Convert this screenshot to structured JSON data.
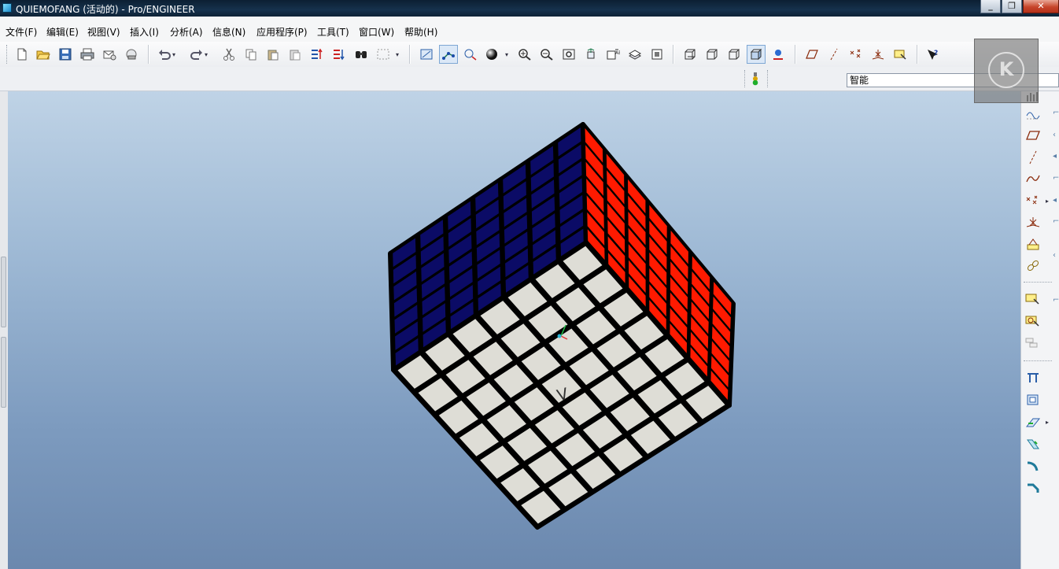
{
  "window": {
    "title": "QUIEMOFANG (活动的) - Pro/ENGINEER",
    "minimize": "_",
    "restore": "❐",
    "close": "✕"
  },
  "menu": [
    "文件(F)",
    "编辑(E)",
    "视图(V)",
    "插入(I)",
    "分析(A)",
    "信息(N)",
    "应用程序(P)",
    "工具(T)",
    "窗口(W)",
    "帮助(H)"
  ],
  "toolbar": {
    "filter_value": "智能"
  },
  "model": {
    "face_label": "V",
    "colors": {
      "top_face": "#0b0b66",
      "right_face": "#ff1a00",
      "front_face": "#deddd6",
      "gap": "#000000",
      "viewport_top": "#bfd3e6",
      "viewport_bottom": "#6b88ae"
    }
  },
  "overlay": {
    "logo_letter": "K"
  }
}
